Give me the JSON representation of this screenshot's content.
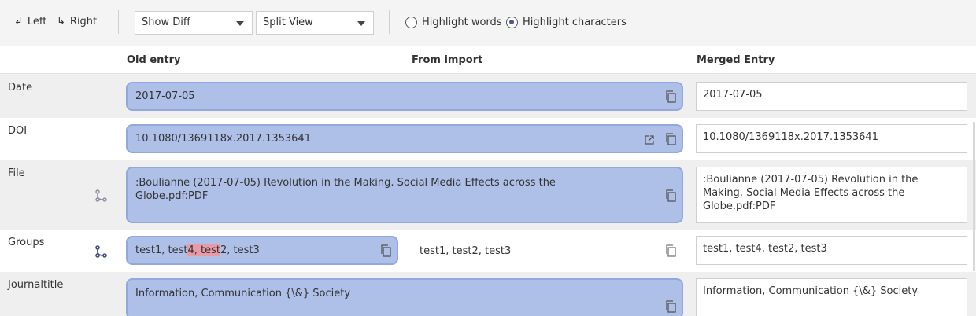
{
  "toolbar": {
    "left_label": "Left",
    "right_label": "Right",
    "diff_mode": "Show Diff",
    "view_mode": "Split View",
    "highlight_words": "Highlight words",
    "highlight_chars": "Highlight characters",
    "highlight_selected": "characters"
  },
  "columns": {
    "old": "Old entry",
    "import": "From import",
    "merged": "Merged Entry"
  },
  "rows": {
    "date": {
      "field": "Date",
      "old": "2017-07-05",
      "merged": "2017-07-05"
    },
    "doi": {
      "field": "DOI",
      "old": "10.1080/1369118x.2017.1353641",
      "merged": "10.1080/1369118x.2017.1353641"
    },
    "file": {
      "field": "File",
      "old_line1": ":Boulianne (2017-07-05) Revolution in the Making. Social Media Effects across the",
      "old_line2": "Globe.pdf:PDF",
      "merged_line1": ":Boulianne (2017-07-05) Revolution in the",
      "merged_line2": "Making. Social Media Effects across the",
      "merged_line3": "Globe.pdf:PDF"
    },
    "groups": {
      "field": "Groups",
      "old_a": "test1, test",
      "old_diff1": "4, test",
      "old_b": "2, test3",
      "import": "test1, test2, test3",
      "merged": "test1, test4, test2, test3"
    },
    "journal": {
      "field": "Journaltitle",
      "old": "Information, Communication {\\&} Society",
      "merged": "Information, Communication {\\&} Society"
    }
  },
  "colors": {
    "old_bg": "#aebfe8",
    "diff_highlight": "#e89aa6"
  }
}
